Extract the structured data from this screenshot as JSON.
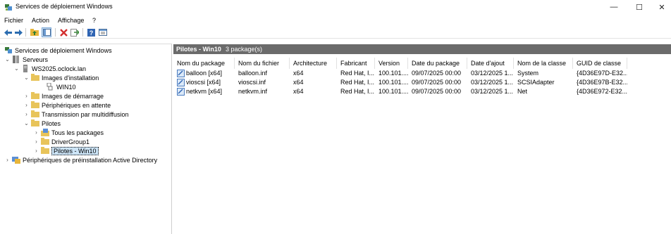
{
  "window": {
    "title": "Services de déploiement Windows",
    "controls": {
      "minimize": "—",
      "maximize": "☐",
      "close": "✕"
    }
  },
  "menu": [
    "Fichier",
    "Action",
    "Affichage",
    "?"
  ],
  "toolbar": {
    "buttons": [
      "back-icon",
      "forward-icon",
      "up-folder-icon",
      "show-hide-tree-icon",
      "delete-icon",
      "export-icon",
      "help-icon",
      "properties-icon"
    ]
  },
  "tree": {
    "root": "Services de déploiement Windows",
    "servers": "Serveurs",
    "server": "WS2025.oclock.lan",
    "install_images": "Images d'installation",
    "win10": "WIN10",
    "boot_images": "Images de démarrage",
    "pending_devices": "Périphériques en attente",
    "multicast": "Transmission par multidiffusion",
    "drivers": "Pilotes",
    "all_packages": "Tous les packages",
    "drivergroup": "DriverGroup1",
    "drivers_win10": "Pilotes - Win10",
    "ad_prestaged": "Périphériques de préinstallation Active Directory"
  },
  "content": {
    "header_title": "Pilotes - Win10",
    "header_count": "3 package(s)",
    "columns": [
      "Nom du package",
      "Nom du fichier",
      "Architecture",
      "Fabricant",
      "Version",
      "Date du package",
      "Date d'ajout",
      "Nom de la classe",
      "GUID de classe"
    ],
    "rows": [
      [
        "balloon [x64]",
        "balloon.inf",
        "x64",
        "Red Hat, I...",
        "100.101....",
        "09/07/2025 00:00",
        "03/12/2025 1...",
        "System",
        "{4D36E97D-E32..."
      ],
      [
        "vioscsi [x64]",
        "vioscsi.inf",
        "x64",
        "Red Hat, I...",
        "100.101....",
        "09/07/2025 00:00",
        "03/12/2025 1...",
        "SCSIAdapter",
        "{4D36E97B-E32..."
      ],
      [
        "netkvm [x64]",
        "netkvm.inf",
        "x64",
        "Red Hat, I...",
        "100.101....",
        "09/07/2025 00:00",
        "03/12/2025 1...",
        "Net",
        "{4D36E972-E32..."
      ]
    ]
  }
}
